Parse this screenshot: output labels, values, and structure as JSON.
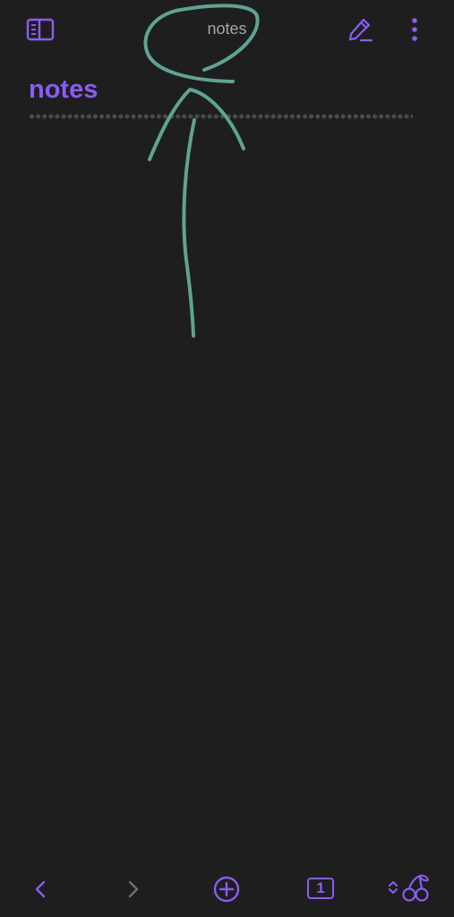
{
  "header": {
    "title": "notes",
    "left_icon": "sidebar-toggle-icon",
    "right_icons": [
      "edit-pencil-icon",
      "more-vertical-icon"
    ]
  },
  "note": {
    "heading": "notes"
  },
  "bottom_bar": {
    "back_icon": "chevron-left-icon",
    "forward_icon": "chevron-right-icon",
    "new_tab_icon": "plus-circle-icon",
    "tab_count": "1",
    "ribbon_icons": [
      "chevrons-updown-icon",
      "cherry-icon"
    ]
  },
  "colors": {
    "accent": "#8a5cf5",
    "background": "#1e1e1e",
    "muted_text": "#a6a6a6",
    "disabled_icon": "#6f6f6f",
    "annotation_stroke": "#5fa394"
  }
}
